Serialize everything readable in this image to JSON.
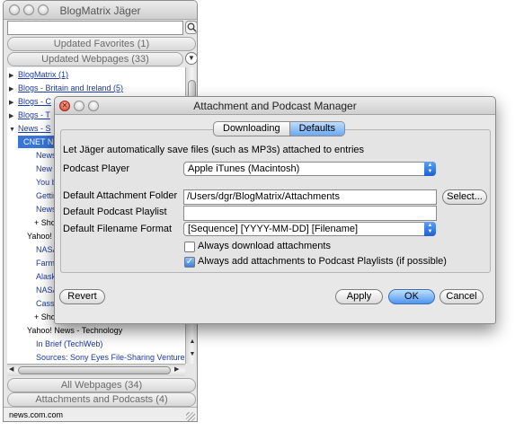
{
  "bg_window": {
    "title": "BlogMatrix Jäger",
    "groups": {
      "updated_favorites": "Updated Favorites (1)",
      "updated_webpages": "Updated Webpages (33)",
      "all_webpages": "All Webpages (34)",
      "attachments": "Attachments and Podcasts (4)"
    },
    "tree": [
      {
        "text": "BlogMatrix (1)"
      },
      {
        "text": "Blogs - Britain and Ireland (5)"
      },
      {
        "text": "Blogs - C"
      },
      {
        "text": "Blogs - T"
      },
      {
        "text": "News - S"
      },
      {
        "text": "CNET N"
      },
      {
        "text": "News"
      },
      {
        "text": "New H"
      },
      {
        "text": "You b"
      },
      {
        "text": "Gettin"
      },
      {
        "text": "News"
      },
      {
        "text": "+ Show"
      },
      {
        "text": "Yahoo! N"
      },
      {
        "text": "NASA"
      },
      {
        "text": "Farmi"
      },
      {
        "text": "Alask"
      },
      {
        "text": "NASA"
      },
      {
        "text": "Cassi"
      },
      {
        "text": "+ Show"
      },
      {
        "text": "Yahoo! News - Technology"
      },
      {
        "text": "In Brief (TechWeb)"
      },
      {
        "text": "Sources: Sony Eyes File-Sharing Venture ("
      }
    ],
    "status": "news.com.com"
  },
  "dialog": {
    "title": "Attachment and Podcast Manager",
    "tabs": [
      "Downloading",
      "Defaults"
    ],
    "active_tab": "Defaults",
    "intro": "Let Jäger automatically save files (such as MP3s) attached to entries",
    "podcast_player_label": "Podcast Player",
    "podcast_player_value": "Apple iTunes (Macintosh)",
    "attachment_folder_label": "Default Attachment Folder",
    "attachment_folder_value": "/Users/dgr/BlogMatrix/Attachments",
    "select_button": "Select...",
    "playlist_label": "Default Podcast Playlist",
    "playlist_value": "",
    "filename_format_label": "Default Filename Format",
    "filename_format_value": "[Sequence] [YYYY-MM-DD] [Filename]",
    "always_download_label": "Always download attachments",
    "always_download_checked": false,
    "always_add_label": "Always add attachments to Podcast Playlists (if possible)",
    "always_add_checked": true,
    "revert_button": "Revert",
    "apply_button": "Apply",
    "ok_button": "OK",
    "cancel_button": "Cancel"
  },
  "colors": {
    "selection": "#3875d7",
    "link": "#1b3aa5",
    "default_button": "#4f95ee"
  }
}
